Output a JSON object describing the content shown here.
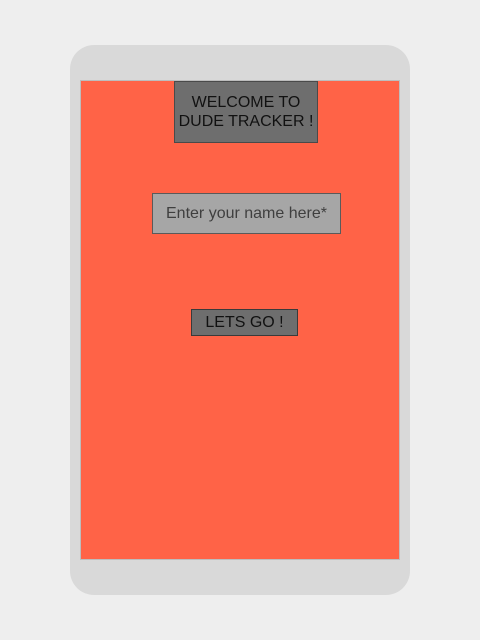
{
  "welcome": {
    "line1": "WELCOME TO",
    "line2": "DUDE TRACKER !"
  },
  "name_input": {
    "value": "",
    "placeholder": "Enter your name here*"
  },
  "go_button": {
    "label": "LETS GO !"
  },
  "colors": {
    "screen_background": "#ff6347",
    "banner_background": "#6e6e6e",
    "input_background": "#a6a6a6",
    "device_frame": "#d9d9d9"
  }
}
